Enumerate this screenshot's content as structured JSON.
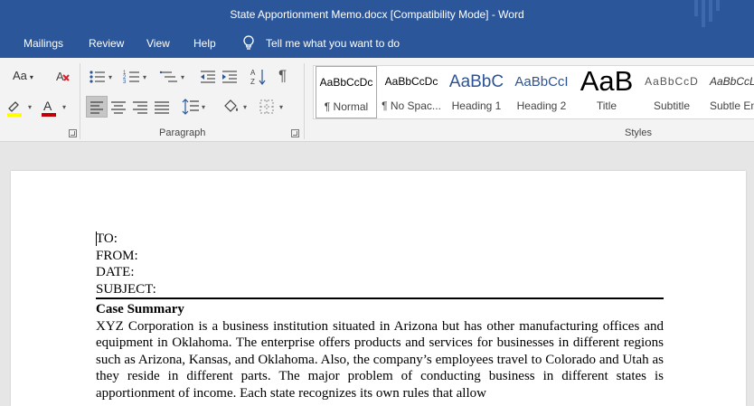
{
  "window": {
    "title": "State Apportionment Memo.docx [Compatibility Mode]  -  Word"
  },
  "tabs": [
    "Mailings",
    "Review",
    "View",
    "Help"
  ],
  "tell_me": "Tell me what you want to do",
  "ribbon": {
    "font_group": {
      "change_case_label": "Aa",
      "font_color": "#c00000",
      "highlight_color": "#ffff00"
    },
    "paragraph_group": {
      "label": "Paragraph"
    },
    "styles_group": {
      "label": "Styles",
      "items": [
        {
          "preview": "AaBbCcDc",
          "name": "¶ Normal"
        },
        {
          "preview": "AaBbCcDc",
          "name": "¶ No Spac..."
        },
        {
          "preview": "AaBbC",
          "name": "Heading 1"
        },
        {
          "preview": "AaBbCcI",
          "name": "Heading 2"
        },
        {
          "preview": "AaB",
          "name": "Title"
        },
        {
          "preview": "AaBbCcD",
          "name": "Subtitle"
        },
        {
          "preview": "AaBbCcL",
          "name": "Subtle Em"
        }
      ]
    }
  },
  "document": {
    "to": "TO:",
    "from": "FROM:",
    "date": "DATE:",
    "subject": "SUBJECT:",
    "heading": "Case Summary",
    "body": "XYZ Corporation is a business institution situated in Arizona but has other manufacturing offices and equipment in Oklahoma. The enterprise offers products and services for businesses in different regions such as Arizona, Kansas, and Oklahoma. Also, the company’s employees travel to Colorado and Utah as they reside in different parts. The major problem of conducting business in different states is apportionment of income. Each state recognizes its own rules that allow"
  }
}
